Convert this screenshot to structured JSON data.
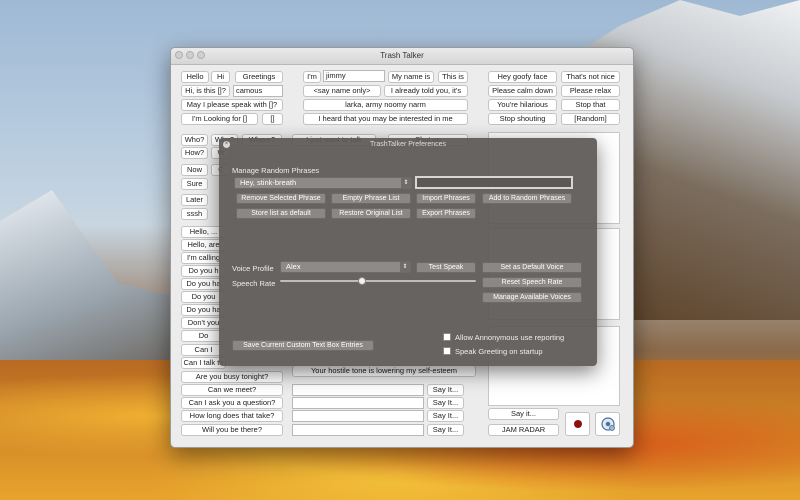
{
  "window": {
    "title": "Trash Talker"
  },
  "greetings": {
    "hello": "Hello",
    "hi": "Hi",
    "greetings": "Greetings",
    "hi_is_this": "Hi, is this []?",
    "name_field": "camous",
    "may_i_speak": "May I please speak with []?",
    "looking_for": "I'm Looking for []",
    "bracket": "[]"
  },
  "intro": {
    "im": "I'm",
    "name_value": "jimmy",
    "my_name_is": "My name is",
    "this_is": "This is",
    "say_name_only": "<say name only>",
    "already_told": "I already told you, it's",
    "larka": "larka, army noomy narm",
    "heard_interested": "I heard that you may be interested in me"
  },
  "retorts": {
    "goofy_face": "Hey goofy face",
    "not_nice": "That's not nice",
    "calm_down": "Please calm down",
    "relax": "Please relax",
    "hilarious": "You're hilarious",
    "stop_that": "Stop that",
    "stop_shouting": "Stop shouting",
    "random": "[Random]"
  },
  "questions": {
    "who": "Who?",
    "why": "Why?",
    "where": "Where?",
    "how": "How?",
    "w": "W",
    "now": "Now",
    "c": "C",
    "sure": "Sure",
    "later": "Later",
    "sssh": "sssh",
    "just_want": "I just want to talk",
    "shut_up": "Shut up"
  },
  "phrases_left": [
    "Hello, ...",
    "Hello, are",
    "I'm calling",
    "Do you h",
    "Do you ha",
    "Do you",
    "Do you ha",
    "Don't you",
    "Do",
    "Can I",
    "Can I talk to"
  ],
  "phrases_bottom": [
    "Are you busy tonight?",
    "Can we meet?",
    "Can I ask you a question?",
    "How long does that take?",
    "Will you be there?"
  ],
  "custom": {
    "hostile": "Your hostile tone is lowering my self-esteem",
    "say_it": "Say It..."
  },
  "right_panel": {
    "say_it": "Say it...",
    "jam_radar": "JAM RADAR"
  },
  "prefs": {
    "title": "TrashTalker Preferences",
    "manage_random": "Manage Random Phrases",
    "selected_phrase": "Hey, stink-breath",
    "phrase_input": "",
    "remove_selected": "Remove Selected Phrase",
    "empty_list": "Empty Phrase List",
    "import": "Import Phrases",
    "add_random": "Add to Random Phrases",
    "store_default": "Store list as default",
    "restore_original": "Restore Original List",
    "export": "Export Phrases",
    "voice_profile_label": "Voice Profile",
    "voice_value": "Alex",
    "test_speak": "Test Speak",
    "set_default_voice": "Set as Default Voice",
    "speech_rate_label": "Speech Rate",
    "speech_rate_fraction": 0.42,
    "reset_speech_rate": "Reset Speech Rate",
    "manage_voices": "Manage Available Voices",
    "save_custom": "Save Current Custom Text Box Entries",
    "allow_anon": "Allow Annonymous use reporting",
    "allow_anon_checked": false,
    "speak_greeting": "Speak Greeting on startup",
    "speak_greeting_checked": false
  }
}
